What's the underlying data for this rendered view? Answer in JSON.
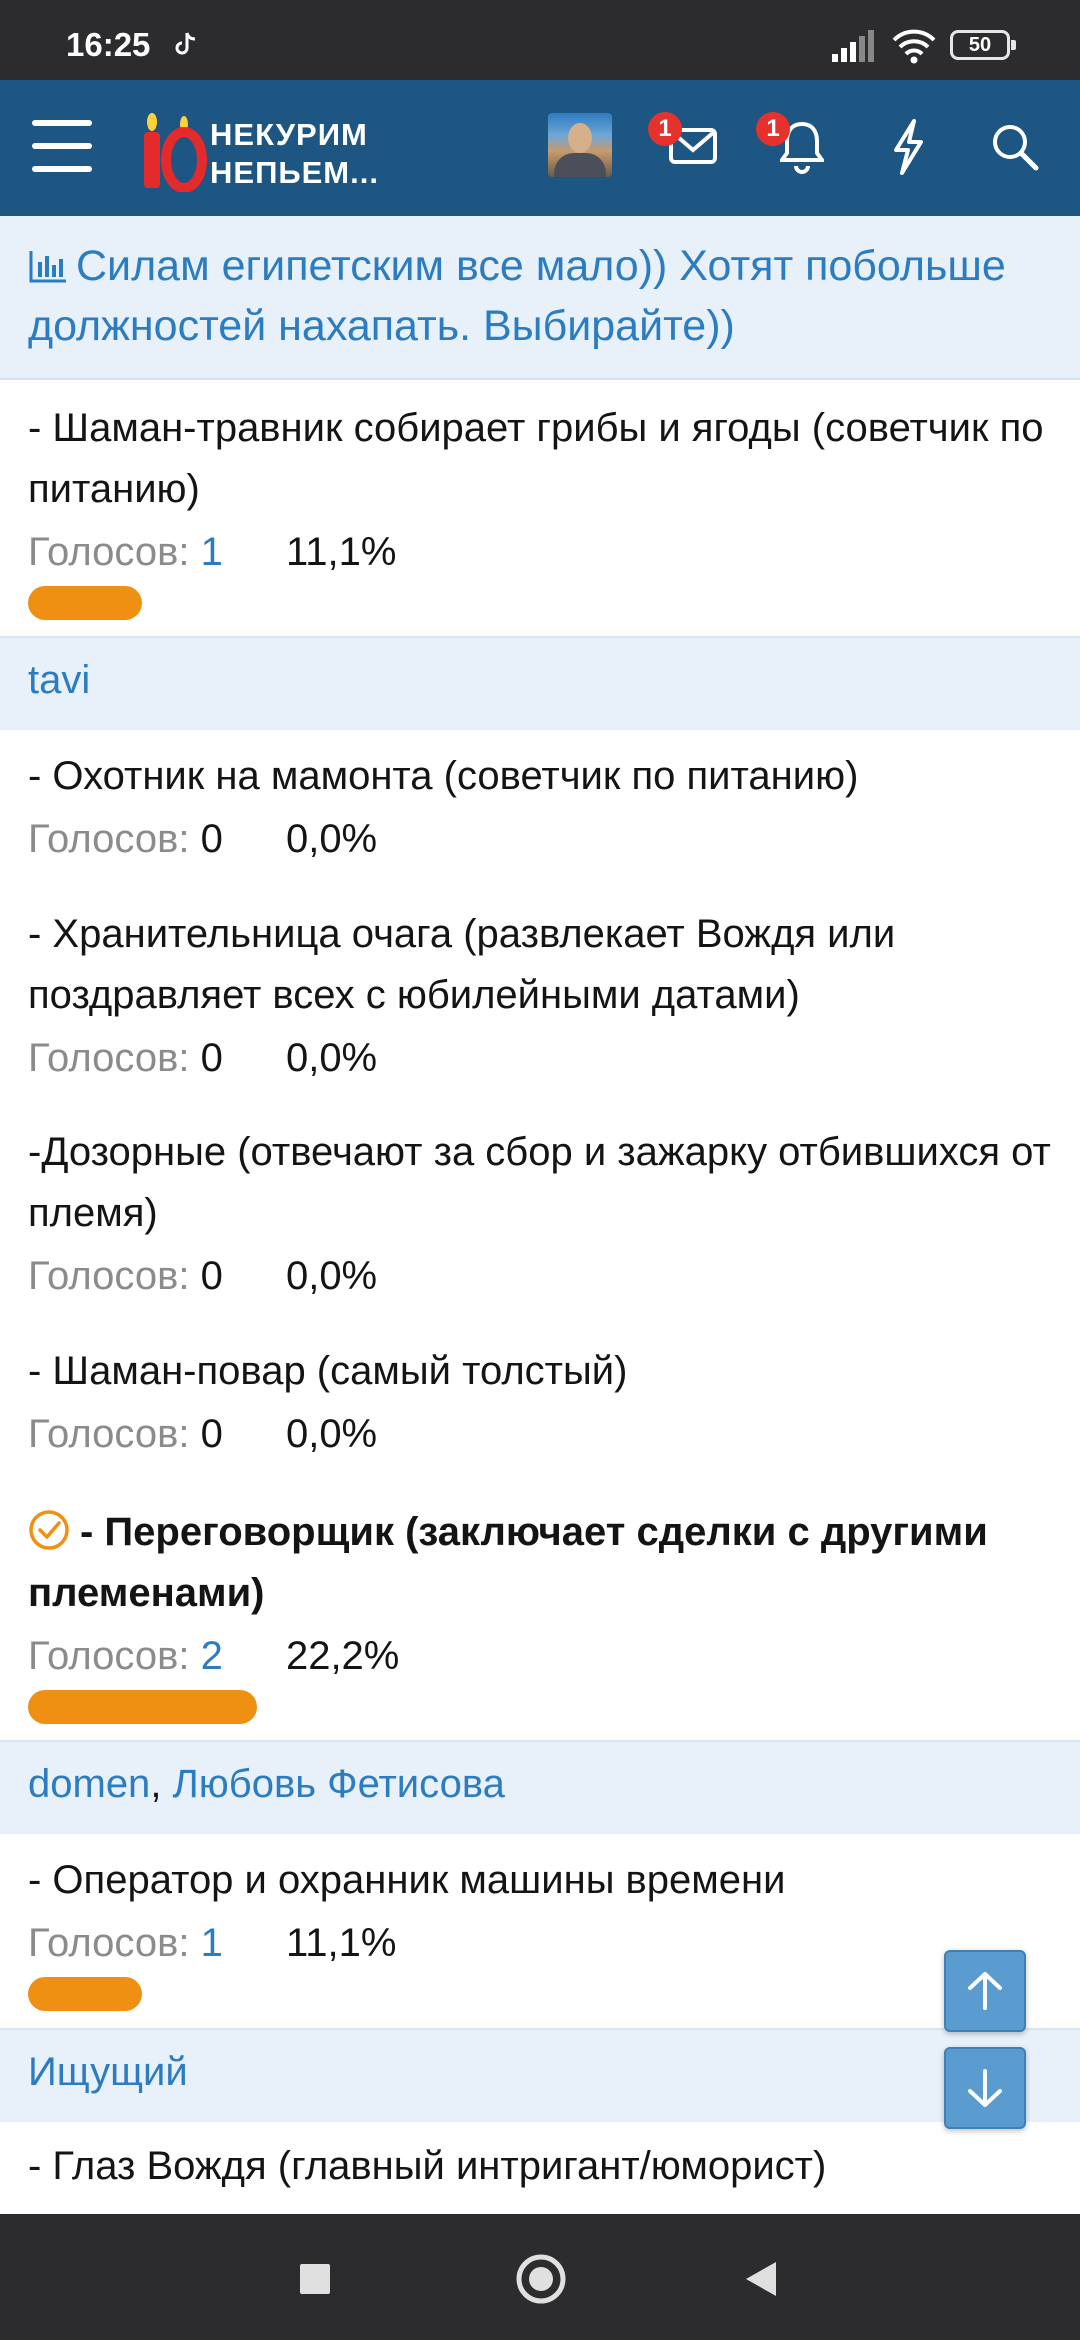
{
  "status_bar": {
    "time": "16:25",
    "battery": "50"
  },
  "app_bar": {
    "logo_line1": "НЕКУРИМ",
    "logo_line2": "НЕПЬЕМ...",
    "logo_number": "10",
    "messages_badge": "1",
    "alerts_badge": "1"
  },
  "poll": {
    "title": "Силам египетским все мало)) Хотят побольше должностей нахапать. Выбирайте))",
    "votes_label": "Голосов:",
    "options": [
      {
        "text": "- Шаман-травник собирает грибы и ягоды (советчик по питанию)",
        "votes": "1",
        "percent": "11,1%",
        "share": 0.111,
        "voters": [
          "tavi"
        ]
      },
      {
        "text": "- Охотник на мамонта (советчик по питанию)",
        "votes": "0",
        "percent": "0,0%",
        "share": 0
      },
      {
        "text": "- Хранительница очага (развлекает Вождя или поздравляет всех с юбилейными датами)",
        "votes": "0",
        "percent": "0,0%",
        "share": 0
      },
      {
        "text": "-Дозорные (отвечают за сбор и зажарку отбившихся от племя)",
        "votes": "0",
        "percent": "0,0%",
        "share": 0
      },
      {
        "text": "- Шаман-повар (самый толстый)",
        "votes": "0",
        "percent": "0,0%",
        "share": 0
      },
      {
        "text": "- Переговорщик (заключает сделки с другими племенами)",
        "votes": "2",
        "percent": "22,2%",
        "share": 0.222,
        "voters": [
          "domen",
          "Любовь Фетисова"
        ],
        "selected": true
      },
      {
        "text": "- Оператор и охранник машины времени",
        "votes": "1",
        "percent": "11,1%",
        "share": 0.111,
        "voters": [
          "Ищущий"
        ]
      },
      {
        "text": "- Глаз Вождя (главный интригант/юморист)"
      }
    ],
    "voter_separator": ", "
  },
  "colors": {
    "accent": "#1d5583",
    "link": "#2b7cc0",
    "bar": "#f09012",
    "voter_band": "#e8f1fa"
  },
  "icons": [
    "menu-icon",
    "mail-icon",
    "bell-icon",
    "bolt-icon",
    "search-icon",
    "poll-chart-icon",
    "check-circle-icon",
    "arrow-up-icon",
    "arrow-down-icon"
  ]
}
